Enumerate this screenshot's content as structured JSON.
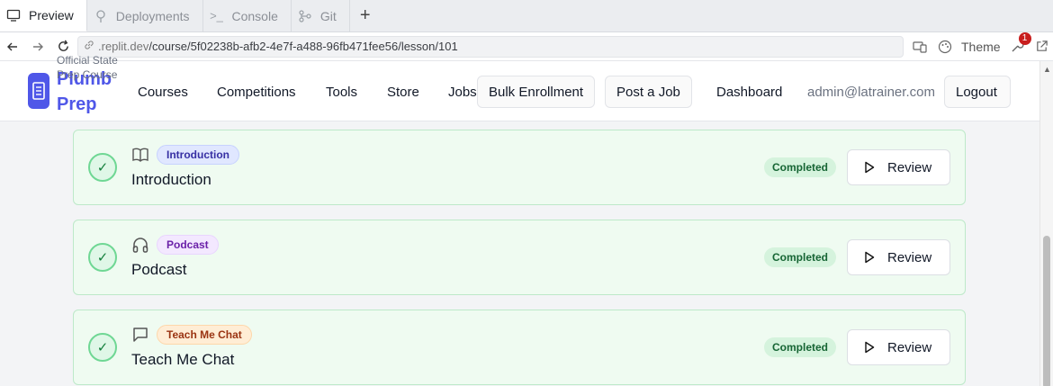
{
  "browser": {
    "tabs": [
      {
        "label": "Preview",
        "icon": "monitor-icon",
        "active": true
      },
      {
        "label": "Deployments",
        "icon": "rocket-icon",
        "active": false
      },
      {
        "label": "Console",
        "icon": "terminal-icon",
        "active": false
      },
      {
        "label": "Git",
        "icon": "git-branch-icon",
        "active": false
      }
    ],
    "new_tab": "+",
    "url_host": ".replit.dev",
    "url_path": "/course/5f02238b-afb2-4e7f-a488-96fb471fee56/lesson/101",
    "theme_label": "Theme",
    "notification_count": "1"
  },
  "header": {
    "brand_line1": "Plumb",
    "brand_line2": "Prep",
    "brand_sub": "Official State Prep Course",
    "nav": [
      "Courses",
      "Competitions",
      "Tools",
      "Store",
      "Jobs"
    ],
    "bulk_enrollment": "Bulk Enrollment",
    "post_job": "Post a Job",
    "dashboard": "Dashboard",
    "email": "admin@latrainer.com",
    "logout": "Logout"
  },
  "lessons": [
    {
      "type_label": "Introduction",
      "title": "Introduction",
      "status": "Completed",
      "action": "Review",
      "icon": "book-open-icon",
      "pill_bg": "#e0e7ff",
      "pill_border": "#c7d2fe",
      "pill_color": "#3730a3"
    },
    {
      "type_label": "Podcast",
      "title": "Podcast",
      "status": "Completed",
      "action": "Review",
      "icon": "headphones-icon",
      "pill_bg": "#f3e8ff",
      "pill_border": "#e9d5ff",
      "pill_color": "#6b21a8"
    },
    {
      "type_label": "Teach Me Chat",
      "title": "Teach Me Chat",
      "status": "Completed",
      "action": "Review",
      "icon": "chat-icon",
      "pill_bg": "#ffedd5",
      "pill_border": "#fed7aa",
      "pill_color": "#9a3412"
    }
  ],
  "colors": {
    "accent": "#4f57e8",
    "success": "#16a34a"
  }
}
